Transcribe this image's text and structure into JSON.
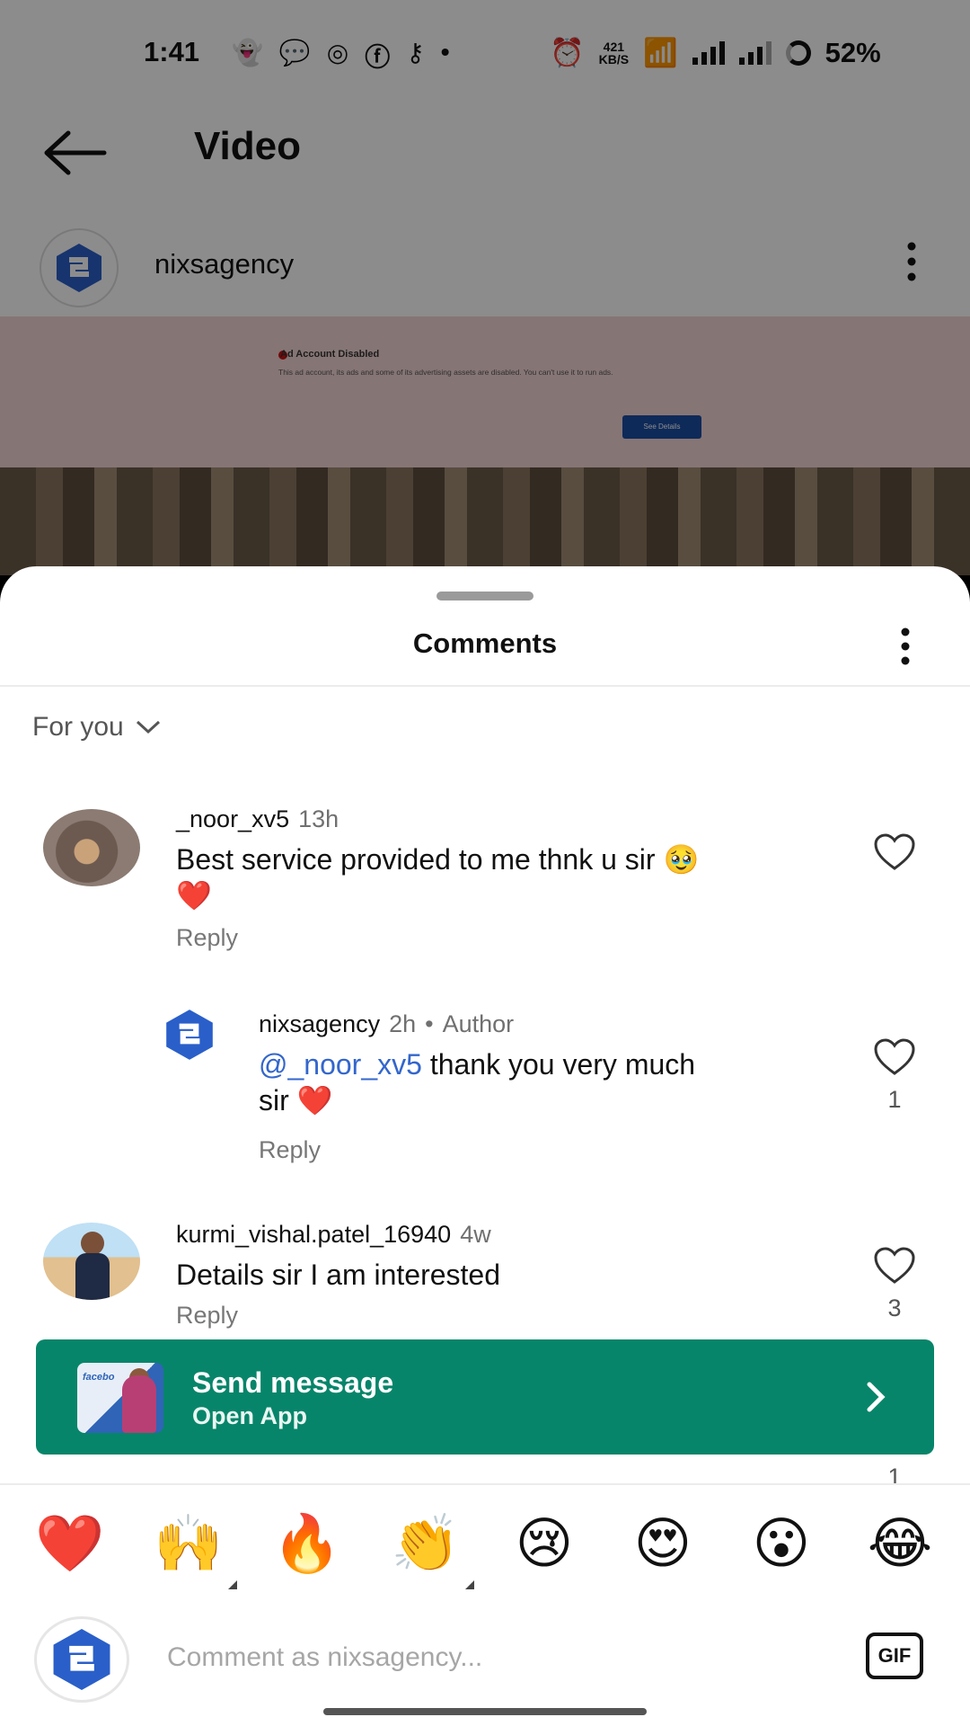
{
  "status_bar": {
    "time": "1:41",
    "net_speed_value": "421",
    "net_speed_unit": "KB/S",
    "battery": "52%"
  },
  "video_page": {
    "title": "Video",
    "owner": "nixsagency",
    "ad_notice": {
      "title": "Ad Account Disabled",
      "text": "This ad account, its ads and some of its advertising assets are disabled. You can't use it to run ads.",
      "button": "See Details"
    }
  },
  "comments_sheet": {
    "title": "Comments",
    "sort_label": "For you",
    "comments": [
      {
        "username": "_noor_xv5",
        "time": "13h",
        "text": "Best service provided to me thnk u sir 🥹",
        "text_emoji": "❤️",
        "reply_label": "Reply"
      },
      {
        "username": "nixsagency",
        "time": "2h",
        "badge": "Author",
        "mention": "@_noor_xv5",
        "text": " thank you very much",
        "text_line2": "sir ❤️",
        "reply_label": "Reply",
        "like_count": "1"
      },
      {
        "username": "kurmi_vishal.patel_16940",
        "time": "4w",
        "text": "Details sir I am interested",
        "reply_label": "Reply",
        "like_count": "3"
      }
    ],
    "partial_reply_count": "1"
  },
  "send_banner": {
    "title": "Send message",
    "subtitle": "Open App"
  },
  "emoji_bar": [
    "❤️",
    "🙌",
    "🔥",
    "👏",
    "😢",
    "😍",
    "😮",
    "😂"
  ],
  "composer": {
    "placeholder": "Comment as nixsagency...",
    "gif_label": "GIF"
  }
}
